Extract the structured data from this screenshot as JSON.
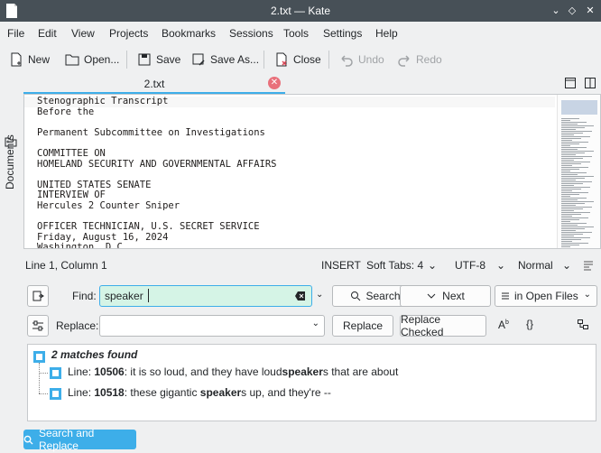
{
  "window": {
    "title": "2.txt — Kate"
  },
  "menu": [
    "File",
    "Edit",
    "View",
    "Projects",
    "Bookmarks",
    "Sessions",
    "Tools",
    "Settings",
    "Help"
  ],
  "toolbar": {
    "new": "New",
    "open": "Open...",
    "save": "Save",
    "save_as": "Save As...",
    "close": "Close",
    "undo": "Undo",
    "redo": "Redo"
  },
  "sidebar": {
    "documents": "Documents"
  },
  "tab": {
    "label": "2.txt"
  },
  "editor": {
    "lines": [
      "Stenographic Transcript",
      "Before the",
      "",
      "Permanent Subcommittee on Investigations",
      "",
      "COMMITTEE ON",
      "HOMELAND SECURITY AND GOVERNMENTAL AFFAIRS",
      "",
      "UNITED STATES SENATE",
      "INTERVIEW OF",
      "Hercules 2 Counter Sniper",
      "",
      "OFFICER TECHNICIAN, U.S. SECRET SERVICE",
      "Friday, August 16, 2024",
      "Washington, D.C."
    ]
  },
  "status": {
    "position": "Line 1, Column 1",
    "mode": "INSERT",
    "tabs": "Soft Tabs: 4",
    "encoding": "UTF-8",
    "highlight": "Normal"
  },
  "search": {
    "find_label": "Find:",
    "find_value": "speaker",
    "replace_label": "Replace:",
    "replace_value": "",
    "search_button": "Search",
    "next_button": "Next",
    "scope": "in Open Files",
    "replace_button": "Replace",
    "replace_checked_button": "Replace Checked",
    "results_header": "2 matches found",
    "results": [
      {
        "prefix": "Line: ",
        "line": "10506",
        "before": ": it is so loud, and they have loud",
        "match": "speaker",
        "after": "s that are about"
      },
      {
        "prefix": "Line: ",
        "line": "10518",
        "before": ": these gigantic ",
        "match": "speaker",
        "after": "s up, and they're --"
      }
    ],
    "search_replace_button": "Search and Replace"
  },
  "colors": {
    "accent": "#3daee9",
    "titlebar": "#475057",
    "find_bg": "#d5f4e6"
  }
}
